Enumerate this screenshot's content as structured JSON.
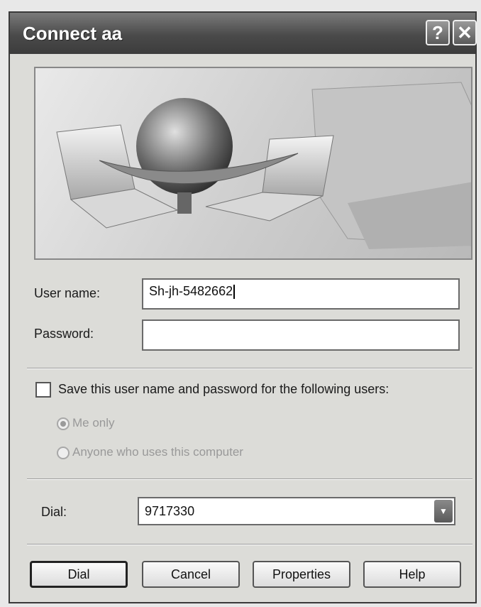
{
  "window": {
    "title": "Connect aa"
  },
  "titlebar": {
    "help_glyph": "?",
    "close_glyph": "✕"
  },
  "form": {
    "username_label": "User name:",
    "username_value": "Sh-jh-5482662",
    "password_label": "Password:",
    "password_value": "",
    "save_label": "Save this user name and password for the following users:",
    "save_checked": false,
    "radio_me_only": "Me only",
    "radio_anyone": "Anyone who uses this computer",
    "dial_label": "Dial:",
    "dial_value": "9717330"
  },
  "buttons": {
    "dial": "Dial",
    "cancel": "Cancel",
    "properties": "Properties",
    "help": "Help"
  },
  "icons": {
    "banner": "network-globe-laptops-illustration",
    "dropdown": "chevron-down-icon"
  }
}
